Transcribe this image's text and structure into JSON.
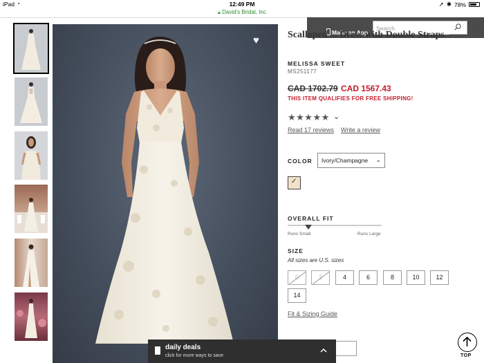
{
  "status_bar": {
    "carrier": "iPad",
    "time": "12:49 PM",
    "battery": "78%",
    "battery_level": 0.78
  },
  "url_bar": {
    "site": "David's Bridal, Inc"
  },
  "overlay": {
    "app_text": "Make an App",
    "search_placeholder": "Search"
  },
  "product": {
    "title": "Scallop ... Double Straps",
    "title_visible": "Scalloped ... Dress with Double Straps",
    "brand": "MELISSA SWEET",
    "sku": "MS251177",
    "price_old": "CAD 1702.79",
    "price_new": "CAD 1567.43",
    "shipping_note": "THIS ITEM QUALIFIES FOR FREE SHIPPING!",
    "rating_stars": "★★★★★",
    "rating": 5,
    "reviews_link": "Read 17 reviews",
    "write_review": "Write a review"
  },
  "color": {
    "label": "COLOR",
    "selected": "Ivory/Champagne",
    "swatch_color": "#efe2c8"
  },
  "fit": {
    "label": "OVERALL FIT",
    "min_label": "Runs Small",
    "max_label": "Runs Large",
    "position": 0.22
  },
  "size": {
    "label": "SIZE",
    "note": "All sizes are U.S. sizes",
    "options": [
      {
        "label": "0",
        "available": false
      },
      {
        "label": "2",
        "available": false
      },
      {
        "label": "4",
        "available": true
      },
      {
        "label": "6",
        "available": true
      },
      {
        "label": "8",
        "available": true
      },
      {
        "label": "10",
        "available": true
      },
      {
        "label": "12",
        "available": true
      },
      {
        "label": "14",
        "available": true
      }
    ],
    "guide_link": "Fit & Sizing Guide"
  },
  "daily_deals": {
    "title": "daily deals",
    "subtitle": "click for more ways to save"
  },
  "back_to_top": {
    "label": "TOP"
  }
}
